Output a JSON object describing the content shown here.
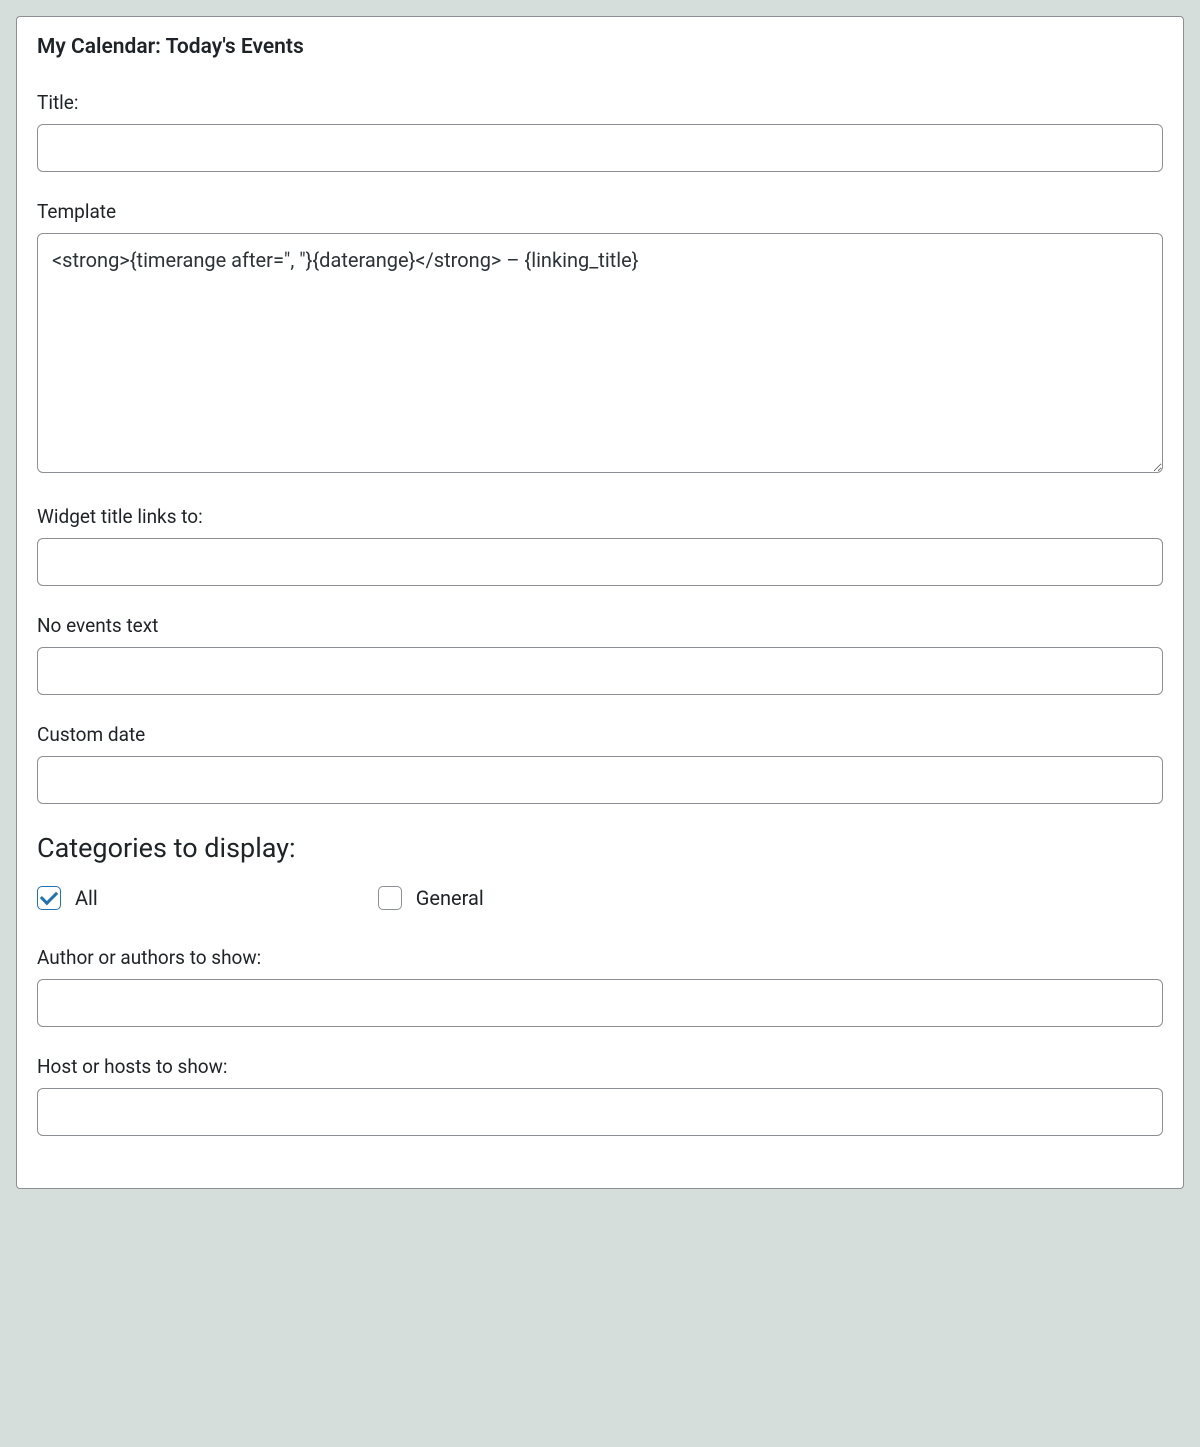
{
  "widget": {
    "title": "My Calendar: Today's Events"
  },
  "fields": {
    "title": {
      "label": "Title:",
      "value": ""
    },
    "template": {
      "label": "Template",
      "value": "<strong>{timerange after=\", \"}{daterange}</strong> – {linking_title}"
    },
    "widget_title_links_to": {
      "label": "Widget title links to:",
      "value": ""
    },
    "no_events_text": {
      "label": "No events text",
      "value": ""
    },
    "custom_date": {
      "label": "Custom date",
      "value": ""
    },
    "author": {
      "label": "Author or authors to show:",
      "value": ""
    },
    "host": {
      "label": "Host or hosts to show:",
      "value": ""
    }
  },
  "categories": {
    "heading": "Categories to display:",
    "options": [
      {
        "label": "All",
        "checked": true
      },
      {
        "label": "General",
        "checked": false
      }
    ]
  }
}
